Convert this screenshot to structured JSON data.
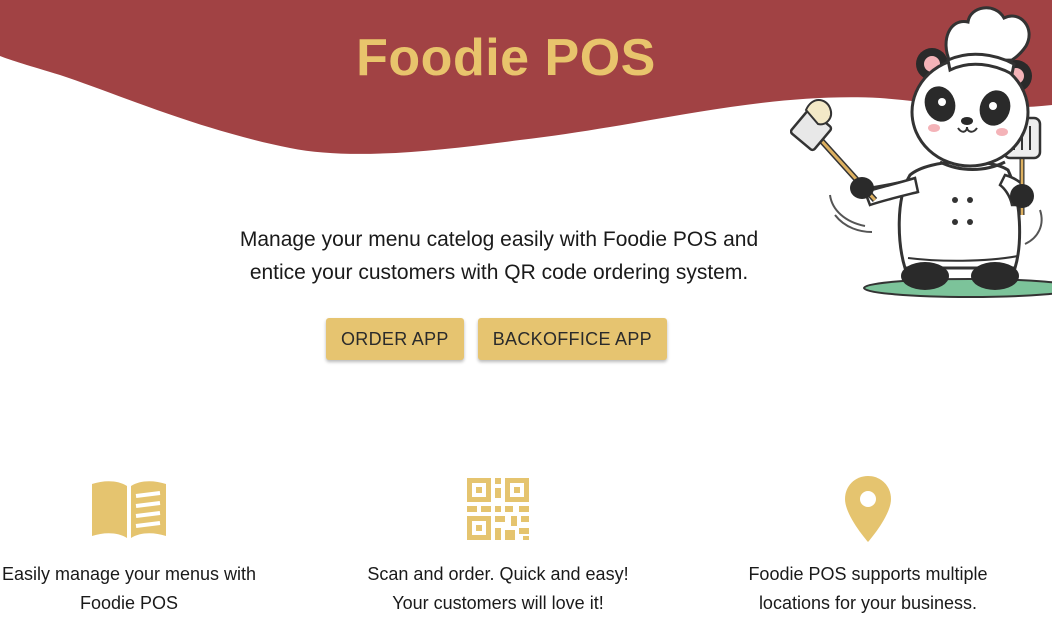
{
  "colors": {
    "brand_red": "#A14244",
    "gold": "#E5C46F",
    "title_gold": "#E8C46C",
    "button_gold": "#E6C470"
  },
  "hero": {
    "title": "Foodie POS",
    "mascot": "panda-chef-illustration",
    "tagline_line1": "Manage your menu catelog easily with Foodie POS and",
    "tagline_line2": "entice your customers with QR code ordering system."
  },
  "actions": {
    "order_app": "ORDER APP",
    "backoffice_app": "BACKOFFICE APP"
  },
  "features": [
    {
      "icon": "menu-book-icon",
      "line1": "Easily manage your menus with",
      "line2": "Foodie POS"
    },
    {
      "icon": "qr-code-icon",
      "line1": "Scan and order. Quick and easy!",
      "line2": "Your customers will love it!"
    },
    {
      "icon": "location-pin-icon",
      "line1": "Foodie POS supports multiple",
      "line2": "locations for your business."
    }
  ]
}
